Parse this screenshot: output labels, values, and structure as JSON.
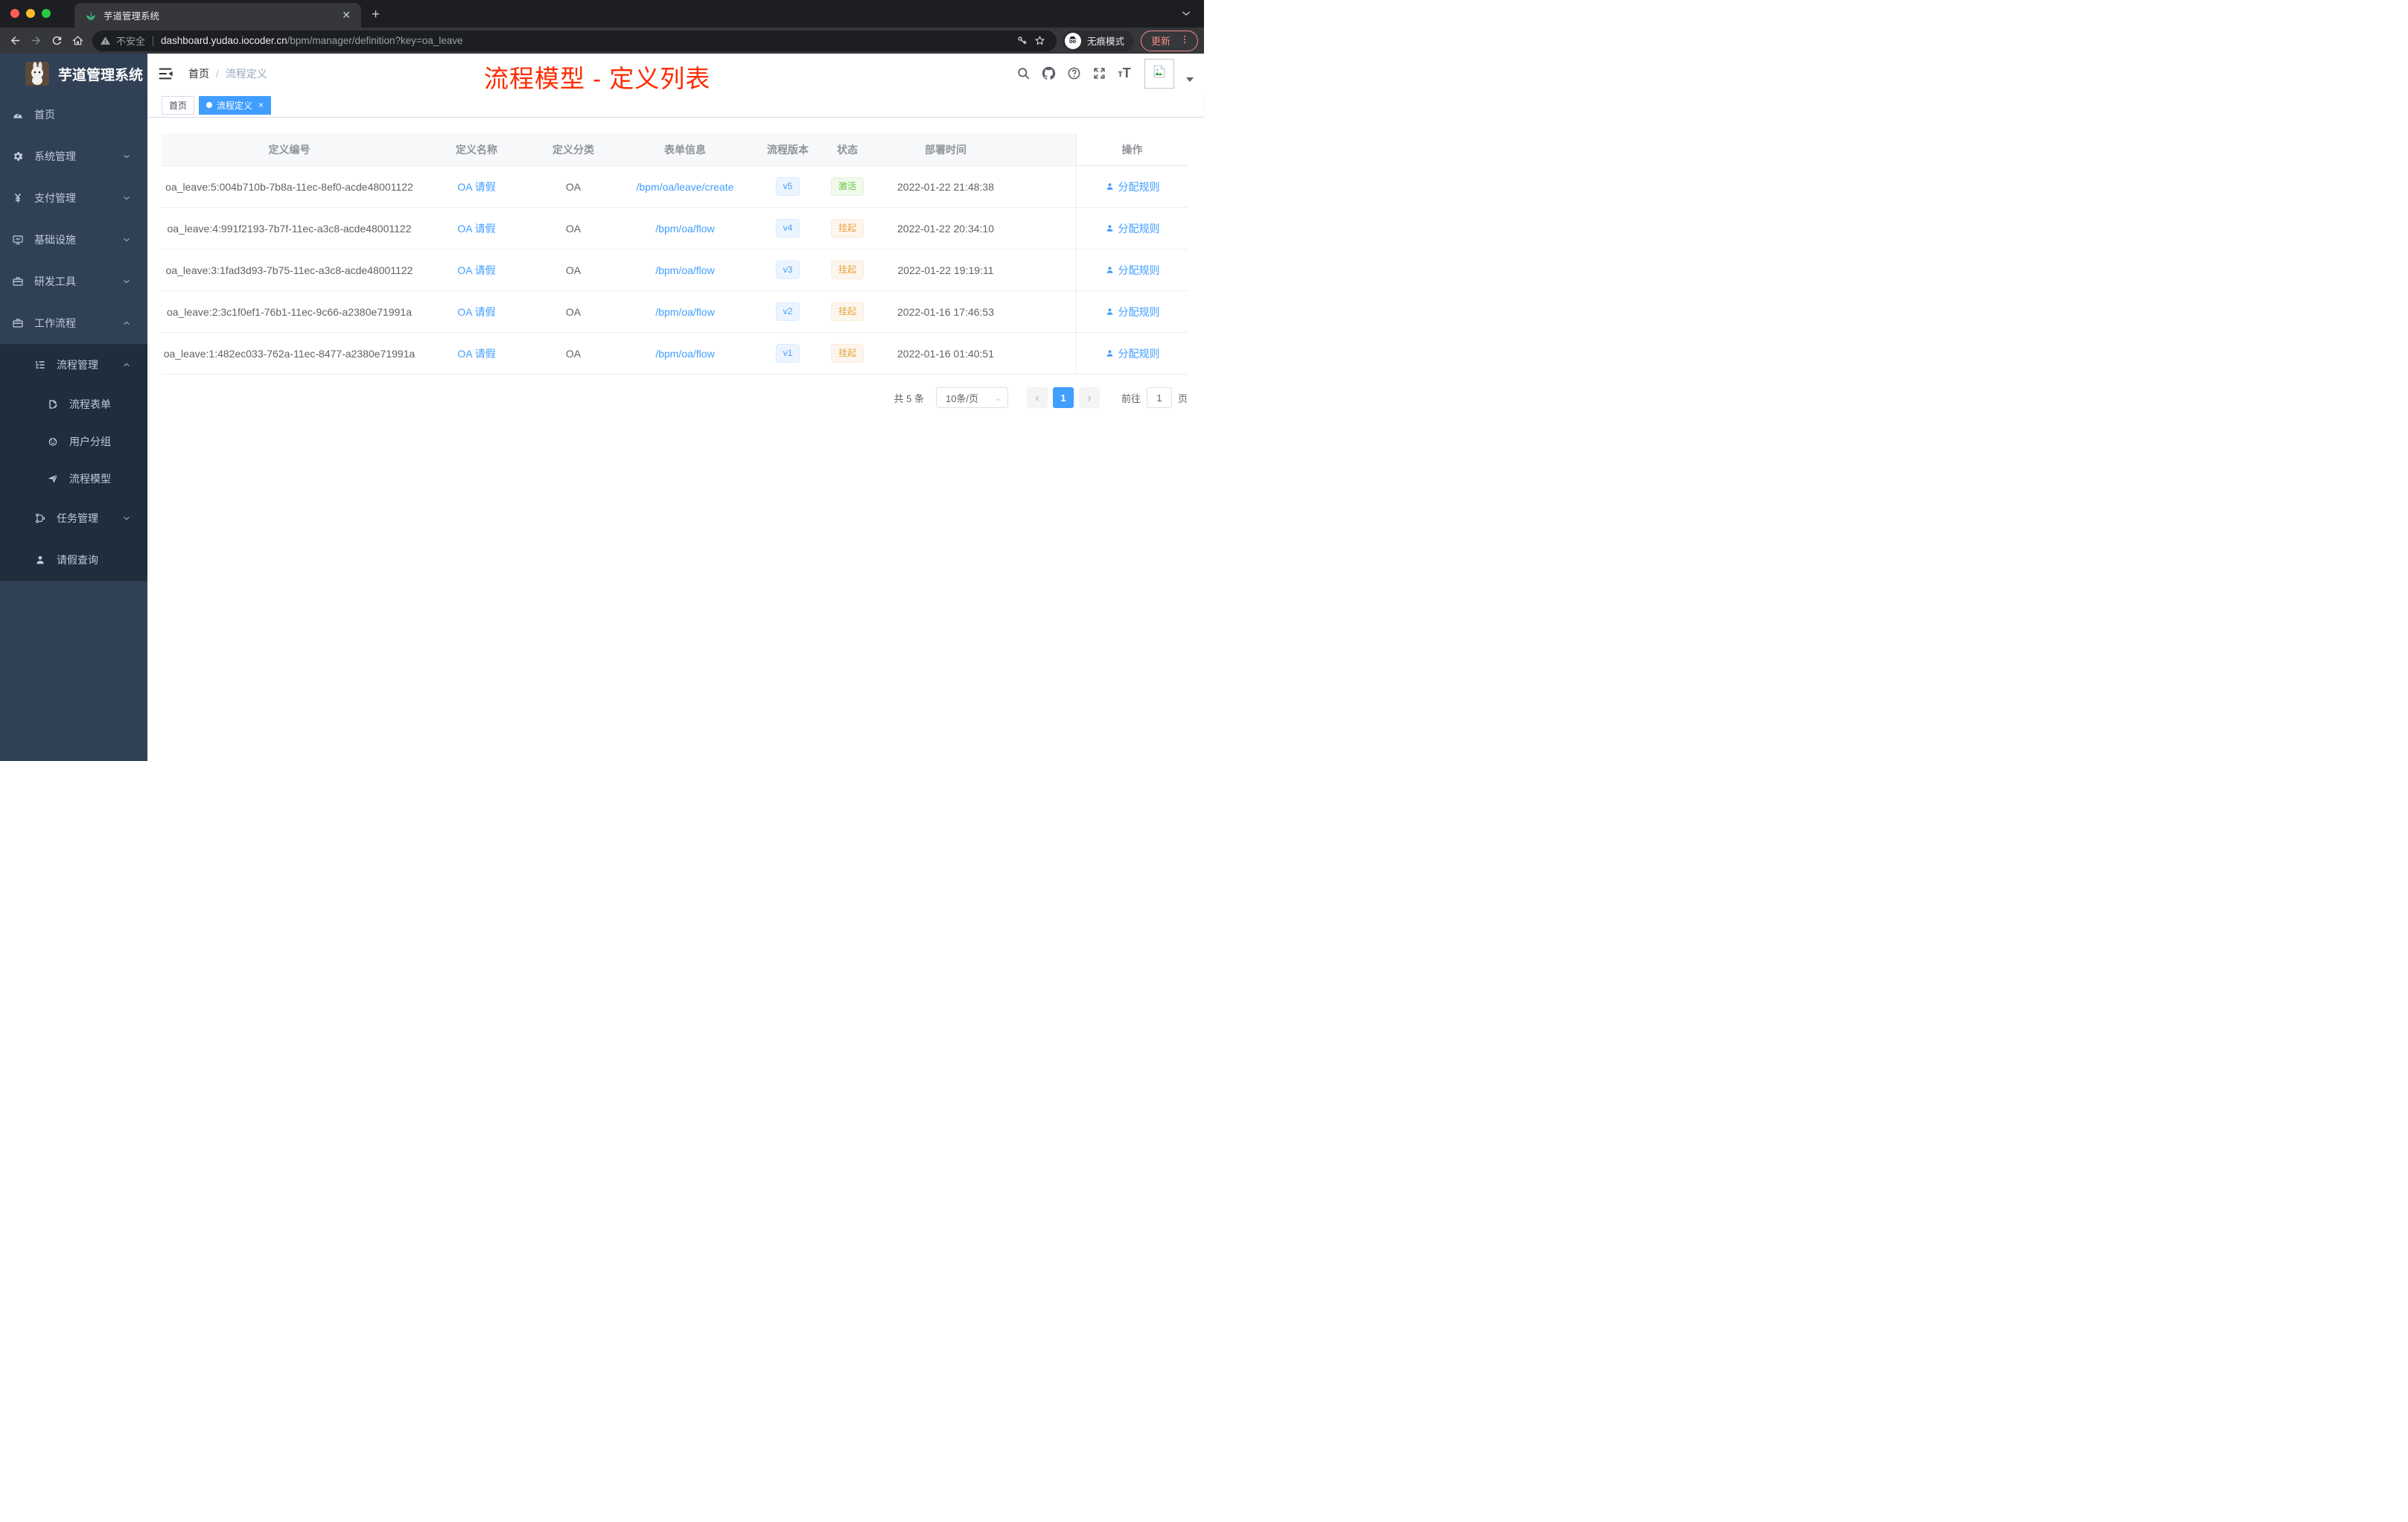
{
  "colors": {
    "accent": "#409eff",
    "success": "#67c23a",
    "warning": "#e6a23c",
    "annotation": "#fe2c00"
  },
  "browser": {
    "tab_title": "芋道管理系统",
    "new_tab_label": "+",
    "close_tab_label": "✕",
    "url": {
      "security": "不安全",
      "host": "dashboard.yudao.iocoder.cn",
      "path": "/bpm/manager/definition?key=oa_leave"
    },
    "incognito_label": "无痕模式",
    "update_label": "更新"
  },
  "sidebar": {
    "title": "芋道管理系统",
    "items": [
      {
        "label": "首页",
        "icon": "dashboard",
        "level": 1
      },
      {
        "label": "系统管理",
        "icon": "gear",
        "level": 1,
        "chevron": "down"
      },
      {
        "label": "支付管理",
        "icon": "yen",
        "level": 1,
        "chevron": "down"
      },
      {
        "label": "基础设施",
        "icon": "monitor",
        "level": 1,
        "chevron": "down"
      },
      {
        "label": "研发工具",
        "icon": "toolbox",
        "level": 1,
        "chevron": "down"
      },
      {
        "label": "工作流程",
        "icon": "toolbox",
        "level": 1,
        "chevron": "up"
      },
      {
        "label": "流程管理",
        "icon": "tree-list",
        "level": 2,
        "chevron": "up",
        "dark": true
      },
      {
        "label": "流程表单",
        "icon": "form",
        "level": 3,
        "dark": true
      },
      {
        "label": "用户分组",
        "icon": "people",
        "level": 3,
        "dark": true
      },
      {
        "label": "流程模型",
        "icon": "send",
        "level": 3,
        "dark": true
      },
      {
        "label": "任务管理",
        "icon": "flow",
        "level": 2,
        "chevron": "down",
        "dark": true
      },
      {
        "label": "请假查询",
        "icon": "user",
        "level": 2,
        "dark": true
      }
    ]
  },
  "navbar": {
    "breadcrumb": {
      "home": "首页",
      "separator": "/",
      "current": "流程定义"
    },
    "annotation": "流程模型 - 定义列表",
    "icons": [
      "search",
      "github",
      "help",
      "fullscreen",
      "font-size"
    ]
  },
  "tags": [
    {
      "label": "首页",
      "active": false
    },
    {
      "label": "流程定义",
      "active": true,
      "close": "×"
    }
  ],
  "table": {
    "columns": [
      "定义编号",
      "定义名称",
      "定义分类",
      "表单信息",
      "流程版本",
      "状态",
      "部署时间",
      "操作"
    ],
    "rows": [
      {
        "id": "oa_leave:5:004b710b-7b8a-11ec-8ef0-acde48001122",
        "name": "OA 请假",
        "category": "OA",
        "form": "/bpm/oa/leave/create",
        "version": "v5",
        "status": "激活",
        "status_type": "success",
        "time": "2022-01-22 21:48:38",
        "action": "分配规则"
      },
      {
        "id": "oa_leave:4:991f2193-7b7f-11ec-a3c8-acde48001122",
        "name": "OA 请假",
        "category": "OA",
        "form": "/bpm/oa/flow",
        "version": "v4",
        "status": "挂起",
        "status_type": "warning",
        "time": "2022-01-22 20:34:10",
        "action": "分配规则"
      },
      {
        "id": "oa_leave:3:1fad3d93-7b75-11ec-a3c8-acde48001122",
        "name": "OA 请假",
        "category": "OA",
        "form": "/bpm/oa/flow",
        "version": "v3",
        "status": "挂起",
        "status_type": "warning",
        "time": "2022-01-22 19:19:11",
        "action": "分配规则"
      },
      {
        "id": "oa_leave:2:3c1f0ef1-76b1-11ec-9c66-a2380e71991a",
        "name": "OA 请假",
        "category": "OA",
        "form": "/bpm/oa/flow",
        "version": "v2",
        "status": "挂起",
        "status_type": "warning",
        "time": "2022-01-16 17:46:53",
        "action": "分配规则"
      },
      {
        "id": "oa_leave:1:482ec033-762a-11ec-8477-a2380e71991a",
        "name": "OA 请假",
        "category": "OA",
        "form": "/bpm/oa/flow",
        "version": "v1",
        "status": "挂起",
        "status_type": "warning",
        "time": "2022-01-16 01:40:51",
        "action": "分配规则"
      }
    ]
  },
  "pagination": {
    "total": "共 5 条",
    "page_size": "10条/页",
    "prev": "‹",
    "next": "›",
    "current_page": "1",
    "goto_label": "前往",
    "goto_value": "1",
    "page_unit": "页"
  }
}
